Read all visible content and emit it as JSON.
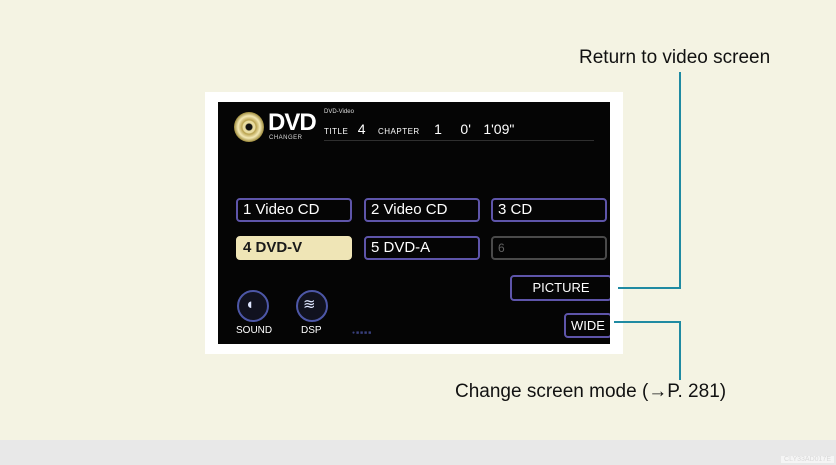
{
  "display": {
    "logo": "DVD",
    "logo_sub": "CHANGER",
    "mode_label": "DVD-Video",
    "title_label": "TITLE",
    "title_number": "4",
    "chapter_label": "CHAPTER",
    "chapter_number": "1",
    "time_minutes": "0'",
    "time_seconds": "1'09\""
  },
  "discs": [
    {
      "label": "1 Video CD"
    },
    {
      "label": "2 Video CD"
    },
    {
      "label": "3 CD"
    },
    {
      "label": "4 DVD-V"
    },
    {
      "label": "5 DVD-A"
    },
    {
      "label": "6"
    }
  ],
  "controls": {
    "picture": "PICTURE",
    "wide": "WIDE",
    "sound": "SOUND",
    "dsp": "DSP",
    "volume_dots": "●■■■■"
  },
  "callouts": {
    "return": "Return to video screen",
    "change": "Change screen mode (→P. 281)"
  },
  "watermark": "CLY33AD017E",
  "colors": {
    "accent": "#5e55aa",
    "active": "#efe5b6",
    "callout": "#1f8aa2"
  }
}
